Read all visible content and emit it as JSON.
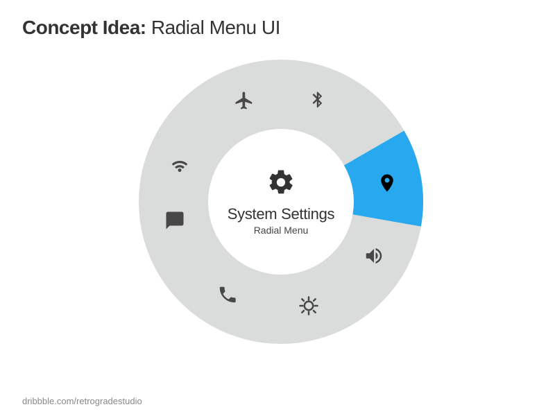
{
  "header": {
    "title_bold": "Concept Idea:",
    "title_light": "Radial Menu UI"
  },
  "footer": {
    "credit": "dribbble.com/retrogradestudio"
  },
  "center": {
    "icon": "gear-icon",
    "title": "System Settings",
    "subtitle": "Radial Menu"
  },
  "colors": {
    "ring": "#dadcdc",
    "active": "#28a8ee",
    "icon": "#474747",
    "active_icon": "#000000"
  },
  "menu": {
    "segment_count": 9,
    "active_index": 2,
    "items": [
      {
        "name": "airplane-mode",
        "icon": "airplane-icon"
      },
      {
        "name": "bluetooth",
        "icon": "bluetooth-icon"
      },
      {
        "name": "location",
        "icon": "location-icon",
        "active": true
      },
      {
        "name": "sound",
        "icon": "speaker-icon"
      },
      {
        "name": "brightness",
        "icon": "brightness-icon"
      },
      {
        "name": "phone",
        "icon": "phone-icon"
      },
      {
        "name": "messages",
        "icon": "message-icon"
      },
      {
        "name": "wifi",
        "icon": "wifi-icon"
      }
    ]
  }
}
